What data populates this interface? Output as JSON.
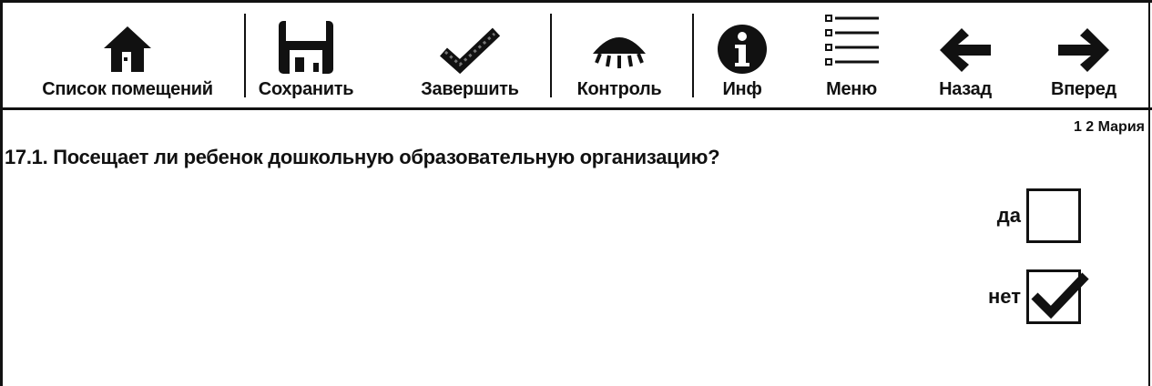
{
  "toolbar": {
    "items": [
      {
        "label": "Список помещений",
        "icon": "house-icon"
      },
      {
        "label": "Сохранить",
        "icon": "floppy-disk-icon"
      },
      {
        "label": "Завершить",
        "icon": "checkmark-icon"
      },
      {
        "label": "Контроль",
        "icon": "eye-icon"
      },
      {
        "label": "Инф",
        "icon": "info-icon"
      },
      {
        "label": "Меню",
        "icon": "menu-list-icon"
      },
      {
        "label": "Назад",
        "icon": "arrow-left-icon"
      },
      {
        "label": "Вперед",
        "icon": "arrow-right-icon"
      }
    ]
  },
  "status": {
    "user": "1 2 Мария"
  },
  "question": {
    "text": "17.1. Посещает ли ребенок дошкольную образовательную организацию?",
    "options": [
      {
        "label": "да",
        "checked": false
      },
      {
        "label": "нет",
        "checked": true
      }
    ]
  }
}
